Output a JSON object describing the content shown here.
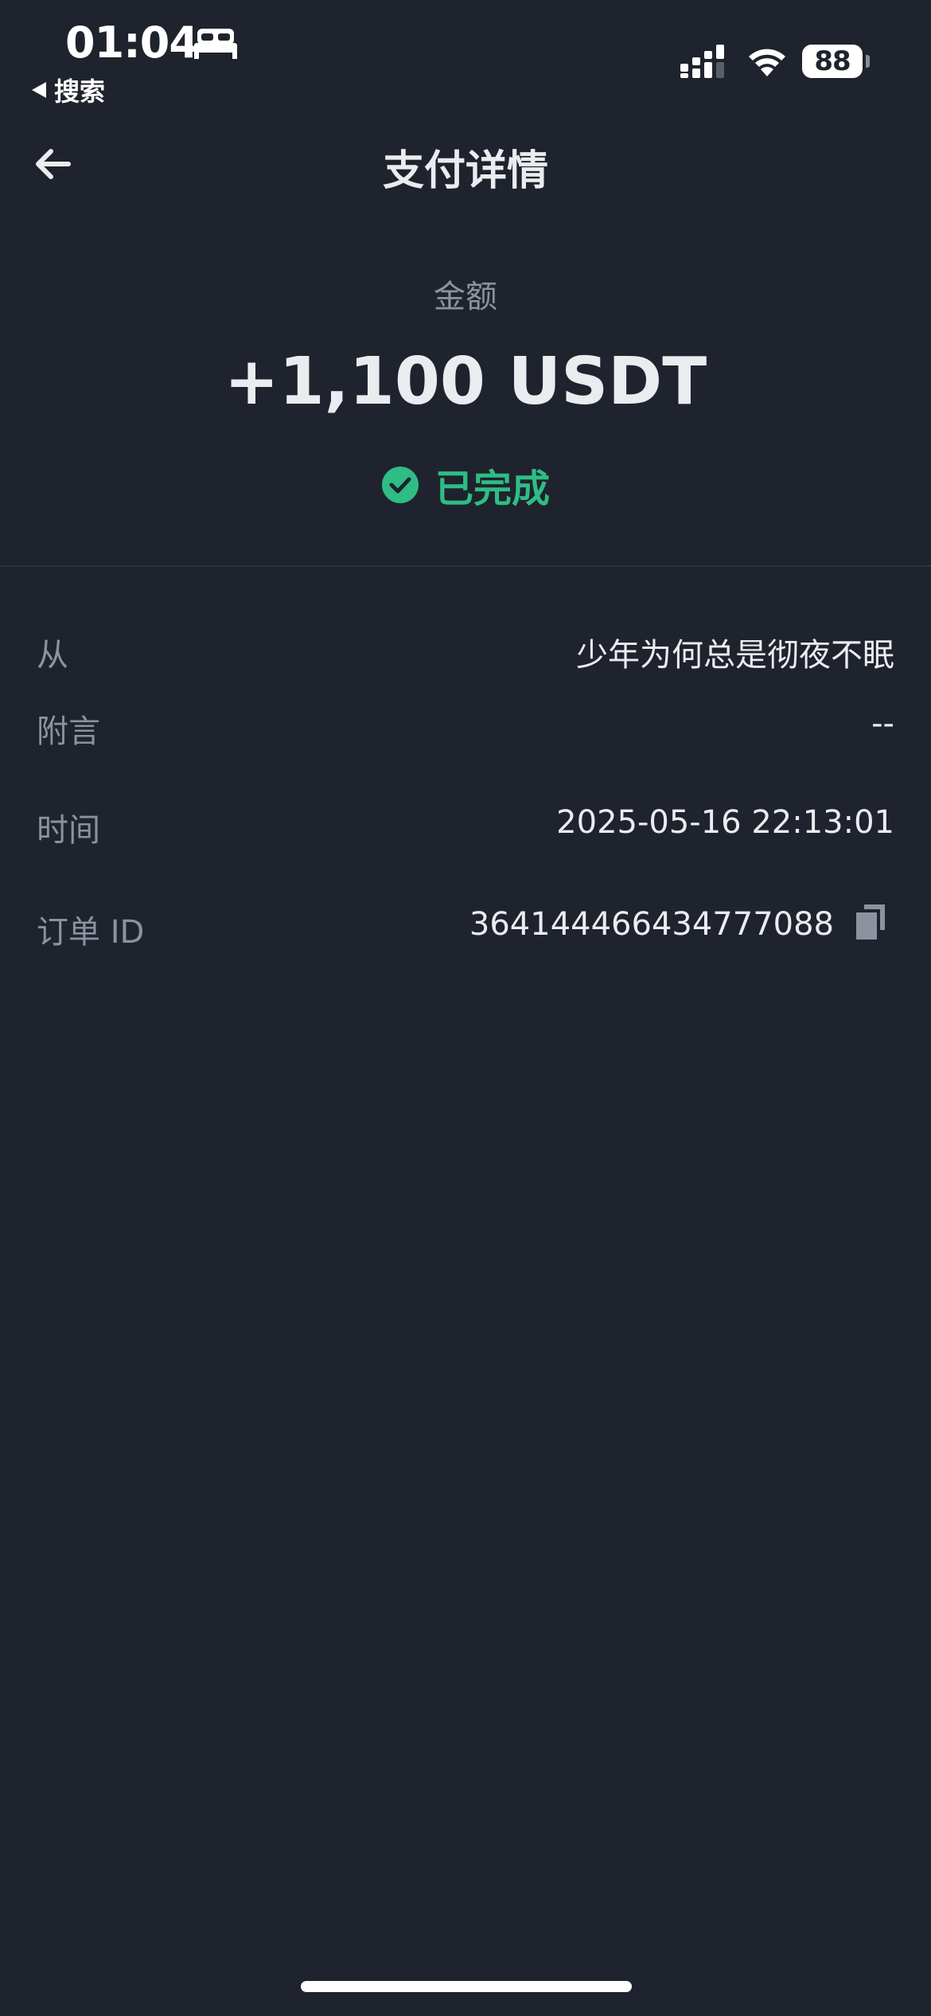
{
  "status_bar": {
    "time": "01:04",
    "back_app_label": "搜索",
    "battery_level": "88"
  },
  "header": {
    "title": "支付详情"
  },
  "amount": {
    "label": "金额",
    "value": "+1,100 USDT",
    "status": "已完成"
  },
  "details": {
    "from_label": "从",
    "from_value": "少年为何总是彻夜不眠",
    "note_label": "附言",
    "note_value": "--",
    "time_label": "时间",
    "time_value": "2025-05-16 22:13:01",
    "order_label": "订单 ID",
    "order_value": "364144466434777088"
  },
  "colors": {
    "background": "#1f232d",
    "success": "#2ebd85",
    "muted_text": "#8c929e",
    "primary_text": "#eaecef"
  }
}
